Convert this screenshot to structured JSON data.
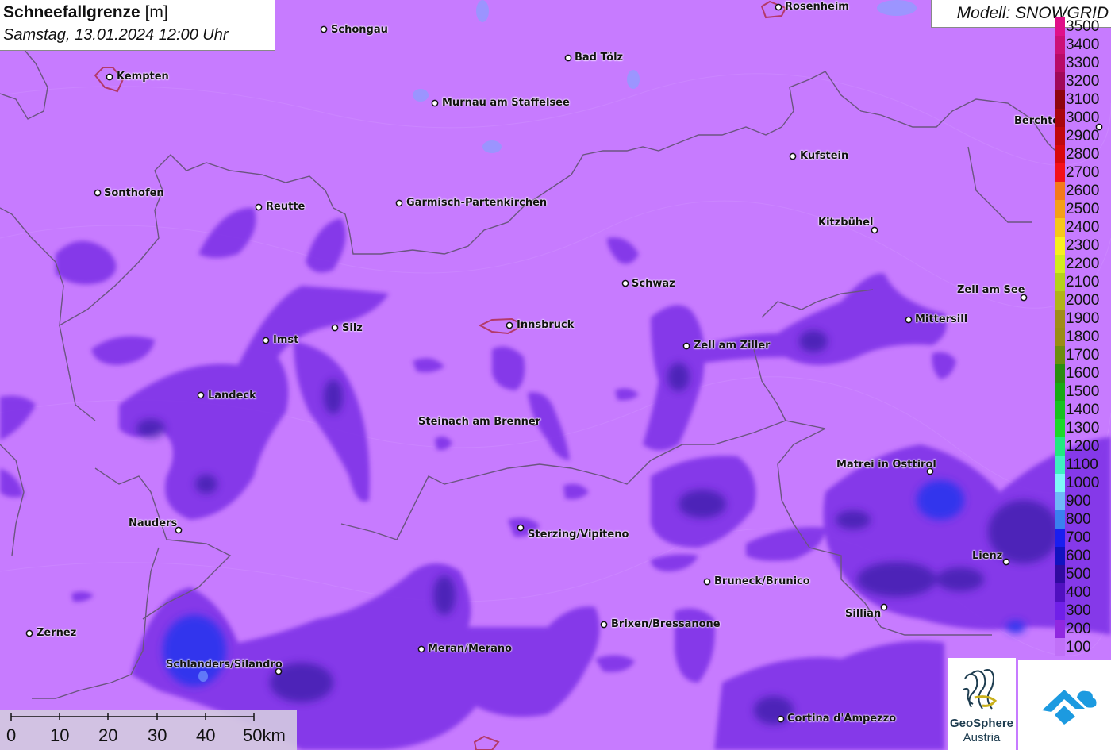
{
  "title": {
    "main_bold": "Schneefallgrenze",
    "main_unit": "[m]",
    "datetime": "Samstag, 13.01.2024 12:00 Uhr"
  },
  "model": {
    "label": "Modell: SNOWGRID"
  },
  "legend": {
    "entries": [
      {
        "label": "3500",
        "color": "#e0108a"
      },
      {
        "label": "3400",
        "color": "#cc1078"
      },
      {
        "label": "3300",
        "color": "#b80a68"
      },
      {
        "label": "3200",
        "color": "#a0085a"
      },
      {
        "label": "3100",
        "color": "#8e0510"
      },
      {
        "label": "3000",
        "color": "#a8060e"
      },
      {
        "label": "2900",
        "color": "#c0080c"
      },
      {
        "label": "2800",
        "color": "#d8080c"
      },
      {
        "label": "2700",
        "color": "#f4101a"
      },
      {
        "label": "2600",
        "color": "#f47a1a"
      },
      {
        "label": "2500",
        "color": "#f4a018"
      },
      {
        "label": "2400",
        "color": "#f6c81a"
      },
      {
        "label": "2300",
        "color": "#f8f020"
      },
      {
        "label": "2200",
        "color": "#d2ee1e"
      },
      {
        "label": "2100",
        "color": "#b4d21a"
      },
      {
        "label": "2000",
        "color": "#b0b418"
      },
      {
        "label": "1900",
        "color": "#a08c18"
      },
      {
        "label": "1800",
        "color": "#9a8c14"
      },
      {
        "label": "1700",
        "color": "#6c8c10"
      },
      {
        "label": "1600",
        "color": "#2a8c10"
      },
      {
        "label": "1500",
        "color": "#18a814"
      },
      {
        "label": "1400",
        "color": "#18c020"
      },
      {
        "label": "1300",
        "color": "#1cd82a"
      },
      {
        "label": "1200",
        "color": "#20e880"
      },
      {
        "label": "1100",
        "color": "#40f0c0"
      },
      {
        "label": "1000",
        "color": "#80f8f8"
      },
      {
        "label": "900",
        "color": "#70b8f8"
      },
      {
        "label": "800",
        "color": "#3a80f0"
      },
      {
        "label": "700",
        "color": "#1a1ef0"
      },
      {
        "label": "600",
        "color": "#1212c0"
      },
      {
        "label": "500",
        "color": "#300aa0"
      },
      {
        "label": "400",
        "color": "#5010c0"
      },
      {
        "label": "300",
        "color": "#7020e8"
      },
      {
        "label": "200",
        "color": "#9028e0"
      },
      {
        "label": "100",
        "color": "#c070f8"
      }
    ]
  },
  "cities": [
    {
      "name": "Rosenheim"
    },
    {
      "name": "Schongau"
    },
    {
      "name": "Kempten"
    },
    {
      "name": "Bad Tölz"
    },
    {
      "name": "Murnau am Staffelsee"
    },
    {
      "name": "Berchte"
    },
    {
      "name": "Kufstein"
    },
    {
      "name": "Sonthofen"
    },
    {
      "name": "Reutte"
    },
    {
      "name": "Garmisch-Partenkirchen"
    },
    {
      "name": "Kitzbühel"
    },
    {
      "name": "Schwaz"
    },
    {
      "name": "Zell am See"
    },
    {
      "name": "Mittersill"
    },
    {
      "name": "Silz"
    },
    {
      "name": "Imst"
    },
    {
      "name": "Innsbruck"
    },
    {
      "name": "Zell am Ziller"
    },
    {
      "name": "Landeck"
    },
    {
      "name": "Steinach am Brenner"
    },
    {
      "name": "Matrei in Osttirol"
    },
    {
      "name": "Nauders"
    },
    {
      "name": "Sterzing/Vipiteno"
    },
    {
      "name": "Lienz"
    },
    {
      "name": "Bruneck/Brunico"
    },
    {
      "name": "Sillian"
    },
    {
      "name": "Zernez"
    },
    {
      "name": "Brixen/Bressanone"
    },
    {
      "name": "Meran/Merano"
    },
    {
      "name": "Schlanders/Silandro"
    },
    {
      "name": "Cortina d'Ampezzo"
    }
  ],
  "scale": {
    "labels": [
      "0",
      "10",
      "20",
      "30",
      "40",
      "50km"
    ]
  },
  "logos": {
    "geosphere_line1": "GeoSphere",
    "geosphere_line2": "Austria"
  },
  "colors": {
    "background": "#c77bff",
    "border": "#6b5580",
    "low_snowline": "#7a2ee6",
    "deep": "#3a1aa8",
    "blue": "#2a36ee"
  }
}
